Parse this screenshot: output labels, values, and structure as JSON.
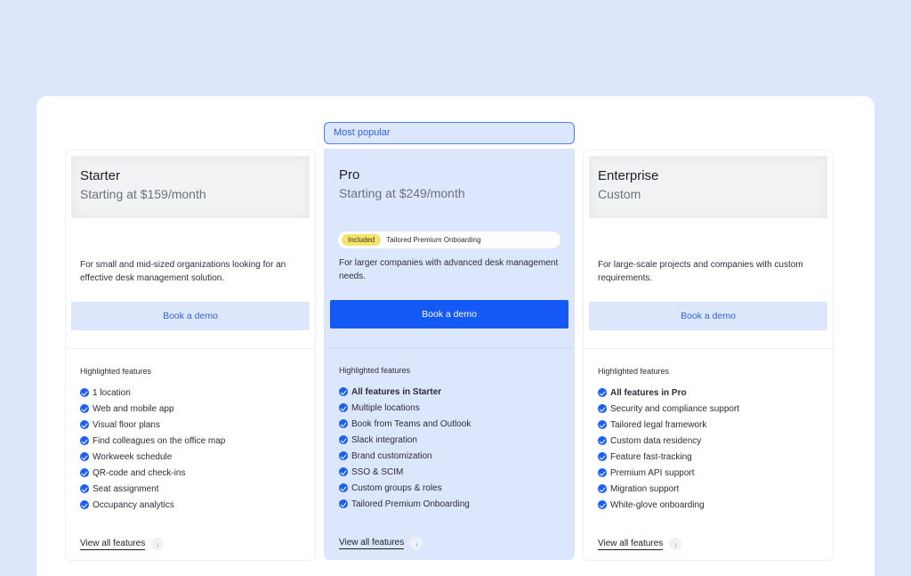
{
  "badge": {
    "most_popular": "Most popular"
  },
  "plans": [
    {
      "name": "Starter",
      "price": "Starting at $159/month",
      "description": "For small and mid-sized organizations looking for an effective desk management solution.",
      "cta": "Book a demo",
      "features_title": "Highlighted features",
      "features": [
        "1 location",
        "Web and mobile app",
        "Visual floor plans",
        "Find colleagues on the office map",
        "Workweek schedule",
        "QR-code and check-ins",
        "Seat assignment",
        "Occupancy analytics"
      ],
      "view_all": "View all features"
    },
    {
      "name": "Pro",
      "price": "Starting at $249/month",
      "included_tag": "Included",
      "included_text": "Tailored Premium Onboarding",
      "description": "For larger companies with advanced desk management needs.",
      "cta": "Book a demo",
      "features_title": "Highlighted features",
      "features": [
        "All features in Starter",
        "Multiple locations",
        "Book from Teams and Outlook",
        "Slack integration",
        "Brand customization",
        "SSO & SCIM",
        "Custom groups & roles",
        "Tailored Premium Onboarding"
      ],
      "view_all": "View all features"
    },
    {
      "name": "Enterprise",
      "price": "Custom",
      "description": "For large-scale projects and companies with custom requirements.",
      "cta": "Book a demo",
      "features_title": "Highlighted features",
      "features": [
        "All features in Pro",
        "Security and compliance support",
        "Tailored legal framework",
        "Custom data residency",
        "Feature fast-tracking",
        "Premium API support",
        "Migration support",
        "White-glove onboarding"
      ],
      "view_all": "View all features"
    }
  ],
  "icons": {
    "check": "check-circle-icon",
    "arrow": "arrow-down-icon"
  },
  "colors": {
    "accent": "#1459f5",
    "background": "#dde7fb",
    "highlight_card": "#dce7fd",
    "included_tag": "#f4e36c"
  }
}
